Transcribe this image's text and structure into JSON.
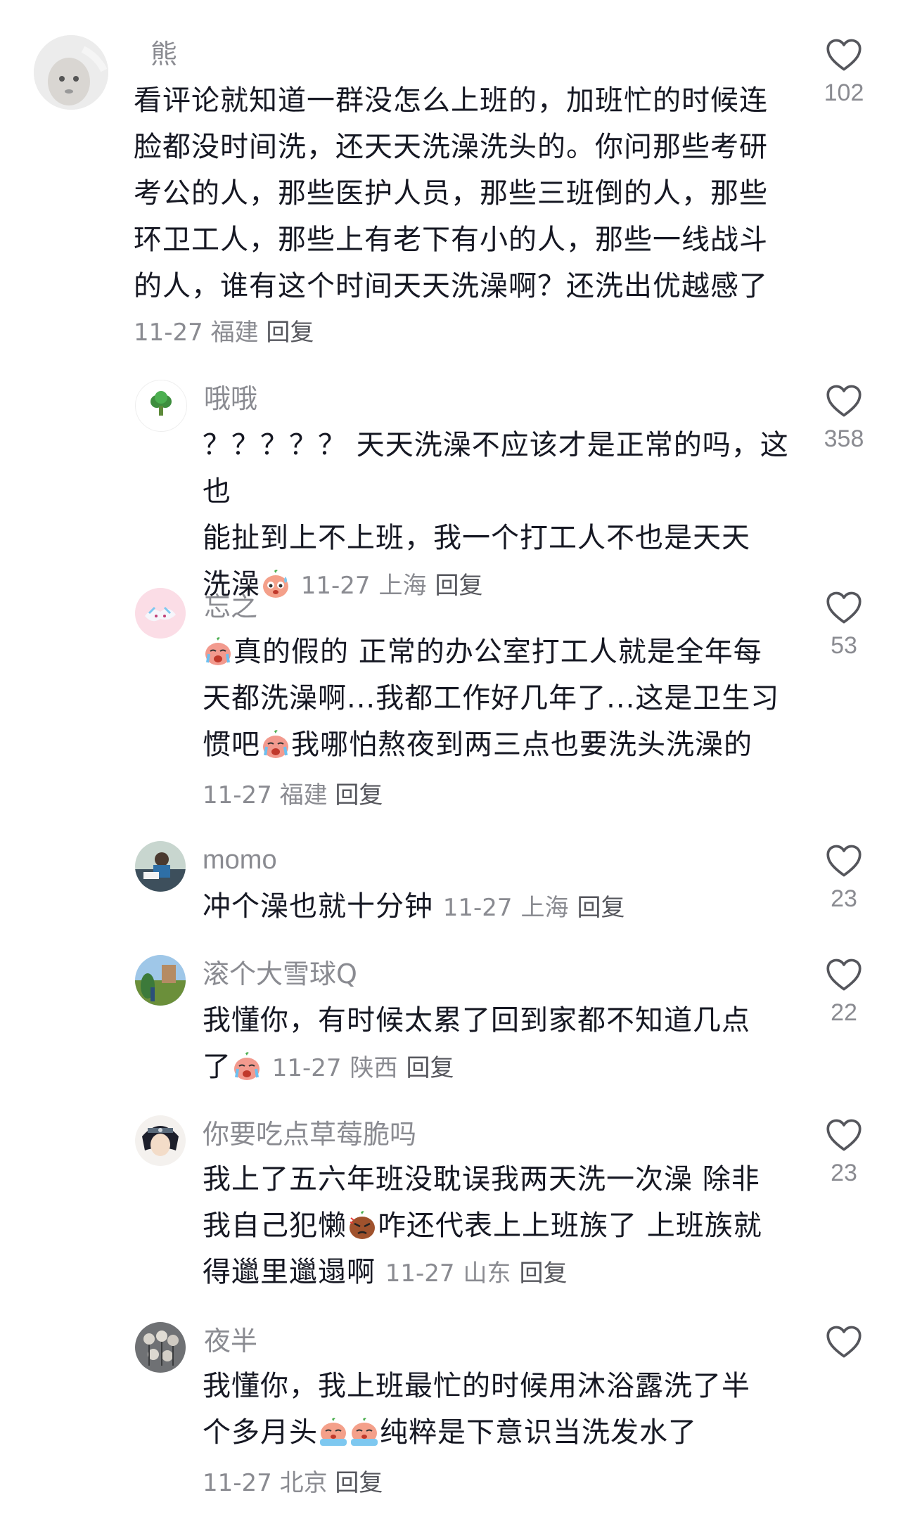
{
  "comments": [
    {
      "user": "熊",
      "lines": [
        "看评论就知道一群没怎么上班的，加班忙的时候连",
        "脸都没时间洗，还天天洗澡洗头的。你问那些考研",
        "考公的人，那些医护人员，那些三班倒的人，那些",
        "环卫工人，那些上有老下有小的人，那些一线战斗",
        "的人，谁有这个时间天天洗澡啊？还洗出优越感了"
      ],
      "date": "11-27",
      "location": "福建",
      "reply": "回复",
      "likes": "102"
    },
    {
      "user": "哦哦",
      "lines": [
        "？？？？？ 天天洗澡不应该才是正常的吗，这也",
        "能扯到上不上班，我一个打工人不也是天天"
      ],
      "last_line_text": "洗澡",
      "date": "11-27",
      "location": "上海",
      "reply": "回复",
      "likes": "358"
    },
    {
      "user": "忘之",
      "line1_text": "真的假的 正常的办公室打工人就是全年每",
      "line2_text": "天都洗澡啊...我都工作好几年了...这是卫生习",
      "line3_a": "惯吧",
      "line3_b": "我哪怕熬夜到两三点也要洗头洗澡的",
      "date": "11-27",
      "location": "福建",
      "reply": "回复",
      "likes": "53"
    },
    {
      "user": "momo",
      "text": "冲个澡也就十分钟",
      "date": "11-27",
      "location": "上海",
      "reply": "回复",
      "likes": "23"
    },
    {
      "user": "滚个大雪球Q",
      "line1_text": "我懂你，有时候太累了回到家都不知道几点",
      "line2_text": "了",
      "date": "11-27",
      "location": "陕西",
      "reply": "回复",
      "likes": "22"
    },
    {
      "user": "你要吃点草莓脆吗",
      "line1_text": "我上了五六年班没耽误我两天洗一次澡 除非",
      "line2_a": "我自己犯懒",
      "line2_b": "咋还代表上上班族了 上班族就",
      "line3_text": "得邋里邋遢啊",
      "date": "11-27",
      "location": "山东",
      "reply": "回复",
      "likes": "23"
    },
    {
      "user": "夜半",
      "line1_text": "我懂你，我上班最忙的时候用沐浴露洗了半",
      "line2_a": "个多月头",
      "line2_b": "纯粹是下意识当洗发水了",
      "date": "11-27",
      "location": "北京",
      "reply": "回复",
      "likes": ""
    }
  ],
  "icons": [
    "heart-outline-icon",
    "emoji-sweat-icon",
    "emoji-cry-icon",
    "emoji-angry-icon",
    "emoji-tears-icon"
  ],
  "colors": {
    "text": "#161823",
    "secondary": "#8a8b91",
    "heart": "#55565c"
  }
}
